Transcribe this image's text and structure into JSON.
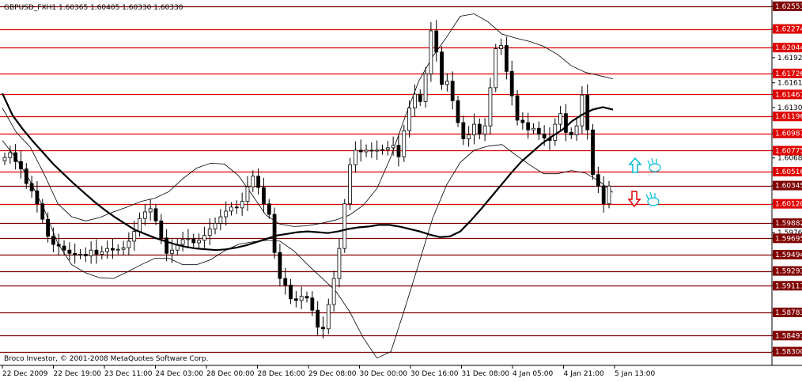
{
  "window": {
    "symbol_line": "GBPUSD_FXH1  1.60365 1.60405 1.60330 1.60330",
    "copyright": "Broco Investor, © 2001-2008 MetaQuotes Software Corp."
  },
  "colors": {
    "background": "#ffffff",
    "candle": "#000000",
    "level_line": "#e00000",
    "level_dark": "#800000",
    "level_tag_bg": "#e00000",
    "level_tag_text": "#ffffff",
    "up_arrow": "#00bcd4",
    "down_arrow": "#e00000",
    "hand_icon": "#00bcd4"
  },
  "signals": [
    {
      "type": "buy",
      "icon": "arrow-up-icon"
    },
    {
      "type": "sell",
      "icon": "arrow-down-icon"
    }
  ],
  "chart_data": {
    "type": "candlestick",
    "ylim": [
      1.5813,
      1.6263
    ],
    "y_ticks": [
      "1.62553",
      "1.62274",
      "1.62044",
      "1.61920",
      "1.61726",
      "1.61610",
      "1.61467",
      "1.61305",
      "1.61196",
      "1.60987",
      "1.60775",
      "1.60685",
      "1.60516",
      "1.60345",
      "1.60120",
      "1.59882",
      "1.59765",
      "1.59695",
      "1.59494",
      "1.59293",
      "1.59111",
      "1.58783",
      "1.58497",
      "1.58300"
    ],
    "x_labels": [
      "22 Dec 2009",
      "22 Dec 19:00",
      "23 Dec 11:00",
      "24 Dec 03:00",
      "28 Dec 00:00",
      "28 Dec 16:00",
      "29 Dec 08:00",
      "30 Dec 00:00",
      "30 Dec 16:00",
      "31 Dec 08:00",
      "4 Jan 05:00",
      "4 Jan 21:00",
      "5 Jan 13:00"
    ],
    "levels": [
      {
        "value": 1.62553,
        "label": "1.62553",
        "tagged": true,
        "style": "dark"
      },
      {
        "value": 1.62274,
        "label": "1.62274",
        "tagged": true,
        "style": "red"
      },
      {
        "value": 1.62044,
        "label": "1.62044",
        "tagged": true,
        "style": "red"
      },
      {
        "value": 1.61726,
        "label": "1.61726",
        "tagged": true,
        "style": "red"
      },
      {
        "value": 1.61467,
        "label": "1.61467",
        "tagged": true,
        "style": "red"
      },
      {
        "value": 1.61196,
        "label": "1.61196",
        "tagged": true,
        "style": "red"
      },
      {
        "value": 1.60987,
        "label": "1.60987",
        "tagged": true,
        "style": "red"
      },
      {
        "value": 1.60775,
        "label": "1.60775",
        "tagged": true,
        "style": "red"
      },
      {
        "value": 1.60516,
        "label": "1.60516",
        "tagged": true,
        "style": "red"
      },
      {
        "value": 1.60345,
        "label": "1.60345",
        "tagged": true,
        "style": "dark"
      },
      {
        "value": 1.6012,
        "label": "1.60120",
        "tagged": true,
        "style": "red"
      },
      {
        "value": 1.59882,
        "label": "1.59882",
        "tagged": true,
        "style": "dark"
      },
      {
        "value": 1.59695,
        "label": "1.59695",
        "tagged": true,
        "style": "dark"
      },
      {
        "value": 1.59494,
        "label": "1.59494",
        "tagged": true,
        "style": "dark"
      },
      {
        "value": 1.59293,
        "label": "1.59293",
        "tagged": true,
        "style": "dark"
      },
      {
        "value": 1.59111,
        "label": "1.59111",
        "tagged": true,
        "style": "dark"
      },
      {
        "value": 1.58783,
        "label": "1.58783",
        "tagged": true,
        "style": "dark"
      },
      {
        "value": 1.58497,
        "label": "1.58497",
        "tagged": true,
        "style": "dark"
      },
      {
        "value": 1.583,
        "label": "1.58300",
        "tagged": true,
        "style": "dark"
      }
    ],
    "series": [
      {
        "kind": "close",
        "values": [
          1.6069,
          1.6075,
          1.6064,
          1.6055,
          1.6037,
          1.6028,
          1.6012,
          1.5993,
          1.5972,
          1.5962,
          1.596,
          1.5955,
          1.5951,
          1.5949,
          1.595,
          1.5948,
          1.5955,
          1.595,
          1.5953,
          1.5957,
          1.5955,
          1.5956,
          1.5958,
          1.5966,
          1.5978,
          1.5994,
          1.6002,
          1.6006,
          1.5991,
          1.597,
          1.5951,
          1.5955,
          1.5962,
          1.5968,
          1.5969,
          1.5964,
          1.5967,
          1.5973,
          1.5981,
          1.5988,
          1.5996,
          1.6003,
          1.6008,
          1.6007,
          1.6015,
          1.6033,
          1.6046,
          1.6032,
          1.6012,
          1.5999,
          1.5952,
          1.592,
          1.5912,
          1.5895,
          1.5893,
          1.5898,
          1.5896,
          1.5881,
          1.586,
          1.5858,
          1.5888,
          1.592,
          1.5957,
          1.6012,
          1.606,
          1.6078,
          1.6076,
          1.6078,
          1.6077,
          1.6078,
          1.6079,
          1.6081,
          1.6084,
          1.607,
          1.6102,
          1.613,
          1.6147,
          1.6138,
          1.6172,
          1.6225,
          1.6199,
          1.6159,
          1.6163,
          1.6139,
          1.6112,
          1.6092,
          1.6097,
          1.611,
          1.6098,
          1.6108,
          1.6155,
          1.6203,
          1.6207,
          1.6175,
          1.6145,
          1.6115,
          1.6112,
          1.6103,
          1.6105,
          1.6098,
          1.6093,
          1.609,
          1.611,
          1.6123,
          1.61,
          1.6097,
          1.6108,
          1.6146,
          1.6103,
          1.6048,
          1.6034,
          1.6012,
          1.6034
        ]
      },
      {
        "kind": "moving_average",
        "values": [
          1.6148,
          1.6121,
          1.6104,
          1.6089,
          1.6075,
          1.6061,
          1.6049,
          1.6037,
          1.6026,
          1.6015,
          1.6005,
          1.5996,
          1.5988,
          1.598,
          1.5975,
          1.597,
          1.5966,
          1.5962,
          1.5959,
          1.5957,
          1.5956,
          1.5955,
          1.5956,
          1.5958,
          1.5961,
          1.5965,
          1.5969,
          1.5973,
          1.5975,
          1.5977,
          1.5978,
          1.5977,
          1.5976,
          1.5978,
          1.5981,
          1.5983,
          1.5984,
          1.5986,
          1.5986,
          1.5984,
          1.5981,
          1.5978,
          1.5974,
          1.5971,
          1.5972,
          1.5978,
          1.5991,
          1.6005,
          1.602,
          1.6035,
          1.605,
          1.6064,
          1.6075,
          1.6086,
          1.6095,
          1.6103,
          1.6114,
          1.6122,
          1.6128,
          1.6131,
          1.6128
        ]
      },
      {
        "kind": "bollinger_upper",
        "values": [
          1.613,
          1.61,
          1.6082,
          1.6049,
          1.6012,
          1.5996,
          1.5991,
          1.5995,
          1.6002,
          1.6008,
          1.6015,
          1.6019,
          1.6027,
          1.6043,
          1.6056,
          1.6062,
          1.6061,
          1.6047,
          1.6023,
          1.5998,
          1.5987,
          1.5984,
          1.5985,
          1.5988,
          1.5992,
          1.5998,
          1.601,
          1.6031,
          1.607,
          1.6118,
          1.6163,
          1.6193,
          1.6217,
          1.6243,
          1.6246,
          1.6236,
          1.6221,
          1.6216,
          1.6212,
          1.6206,
          1.6196,
          1.6182,
          1.6174,
          1.617,
          1.6166
        ]
      },
      {
        "kind": "bollinger_lower",
        "values": [
          1.609,
          1.6068,
          1.604,
          1.6006,
          1.5963,
          1.5937,
          1.5927,
          1.5921,
          1.592,
          1.5928,
          1.5937,
          1.5945,
          1.5945,
          1.5937,
          1.5937,
          1.5943,
          1.5954,
          1.5962,
          1.5965,
          1.5967,
          1.5966,
          1.5954,
          1.5937,
          1.5921,
          1.5905,
          1.588,
          1.5847,
          1.5822,
          1.583,
          1.5883,
          1.5938,
          1.5994,
          1.6035,
          1.6063,
          1.6078,
          1.6083,
          1.6085,
          1.6072,
          1.606,
          1.6049,
          1.6049,
          1.6053,
          1.605,
          1.604,
          1.6026
        ]
      }
    ]
  }
}
